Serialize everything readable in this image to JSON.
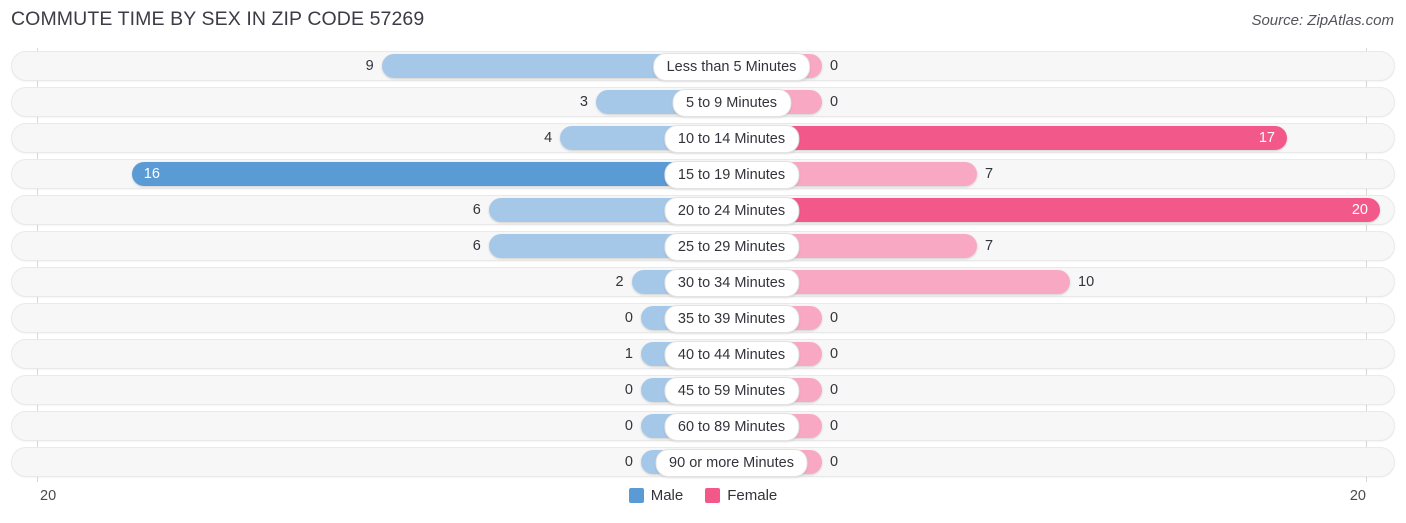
{
  "header": {
    "title": "COMMUTE TIME BY SEX IN ZIP CODE 57269",
    "source": "Source: ZipAtlas.com"
  },
  "axis": {
    "left_tick": "20",
    "right_tick": "20"
  },
  "legend": [
    {
      "label": "Male",
      "color": "#5b9bd5",
      "key": "male"
    },
    {
      "label": "Female",
      "color": "#f2588a",
      "key": "female"
    }
  ],
  "colors": {
    "male_light": "#a6c8e8",
    "male_strong": "#5b9bd5",
    "female_light": "#f9a8c4",
    "female_strong": "#f2588a",
    "track": "#f7f7f7",
    "axis": "#d8d8d8"
  },
  "chart_data": {
    "type": "bar",
    "title": "COMMUTE TIME BY SEX IN ZIP CODE 57269",
    "subtitle": "",
    "xlabel": "",
    "ylabel": "",
    "orientation": "horizontal-diverging",
    "grid": false,
    "legend_position": "bottom-center",
    "axis_max": 20,
    "xlim": [
      20,
      20
    ],
    "categories": [
      "Less than 5 Minutes",
      "5 to 9 Minutes",
      "10 to 14 Minutes",
      "15 to 19 Minutes",
      "20 to 24 Minutes",
      "25 to 29 Minutes",
      "30 to 34 Minutes",
      "35 to 39 Minutes",
      "40 to 44 Minutes",
      "45 to 59 Minutes",
      "60 to 89 Minutes",
      "90 or more Minutes"
    ],
    "series": [
      {
        "name": "Male",
        "side": "left",
        "color": "#5b9bd5",
        "values": [
          9,
          3,
          4,
          16,
          6,
          6,
          2,
          0,
          1,
          0,
          0,
          0
        ],
        "labels": [
          "9",
          "3",
          "4",
          "16",
          "6",
          "6",
          "2",
          "0",
          "1",
          "0",
          "0",
          "0"
        ]
      },
      {
        "name": "Female",
        "side": "right",
        "color": "#f2588a",
        "values": [
          0,
          0,
          17,
          7,
          20,
          7,
          10,
          0,
          0,
          0,
          0,
          0
        ],
        "labels": [
          "0",
          "0",
          "17",
          "7",
          "20",
          "7",
          "10",
          "0",
          "0",
          "0",
          "0",
          "0"
        ]
      }
    ]
  }
}
